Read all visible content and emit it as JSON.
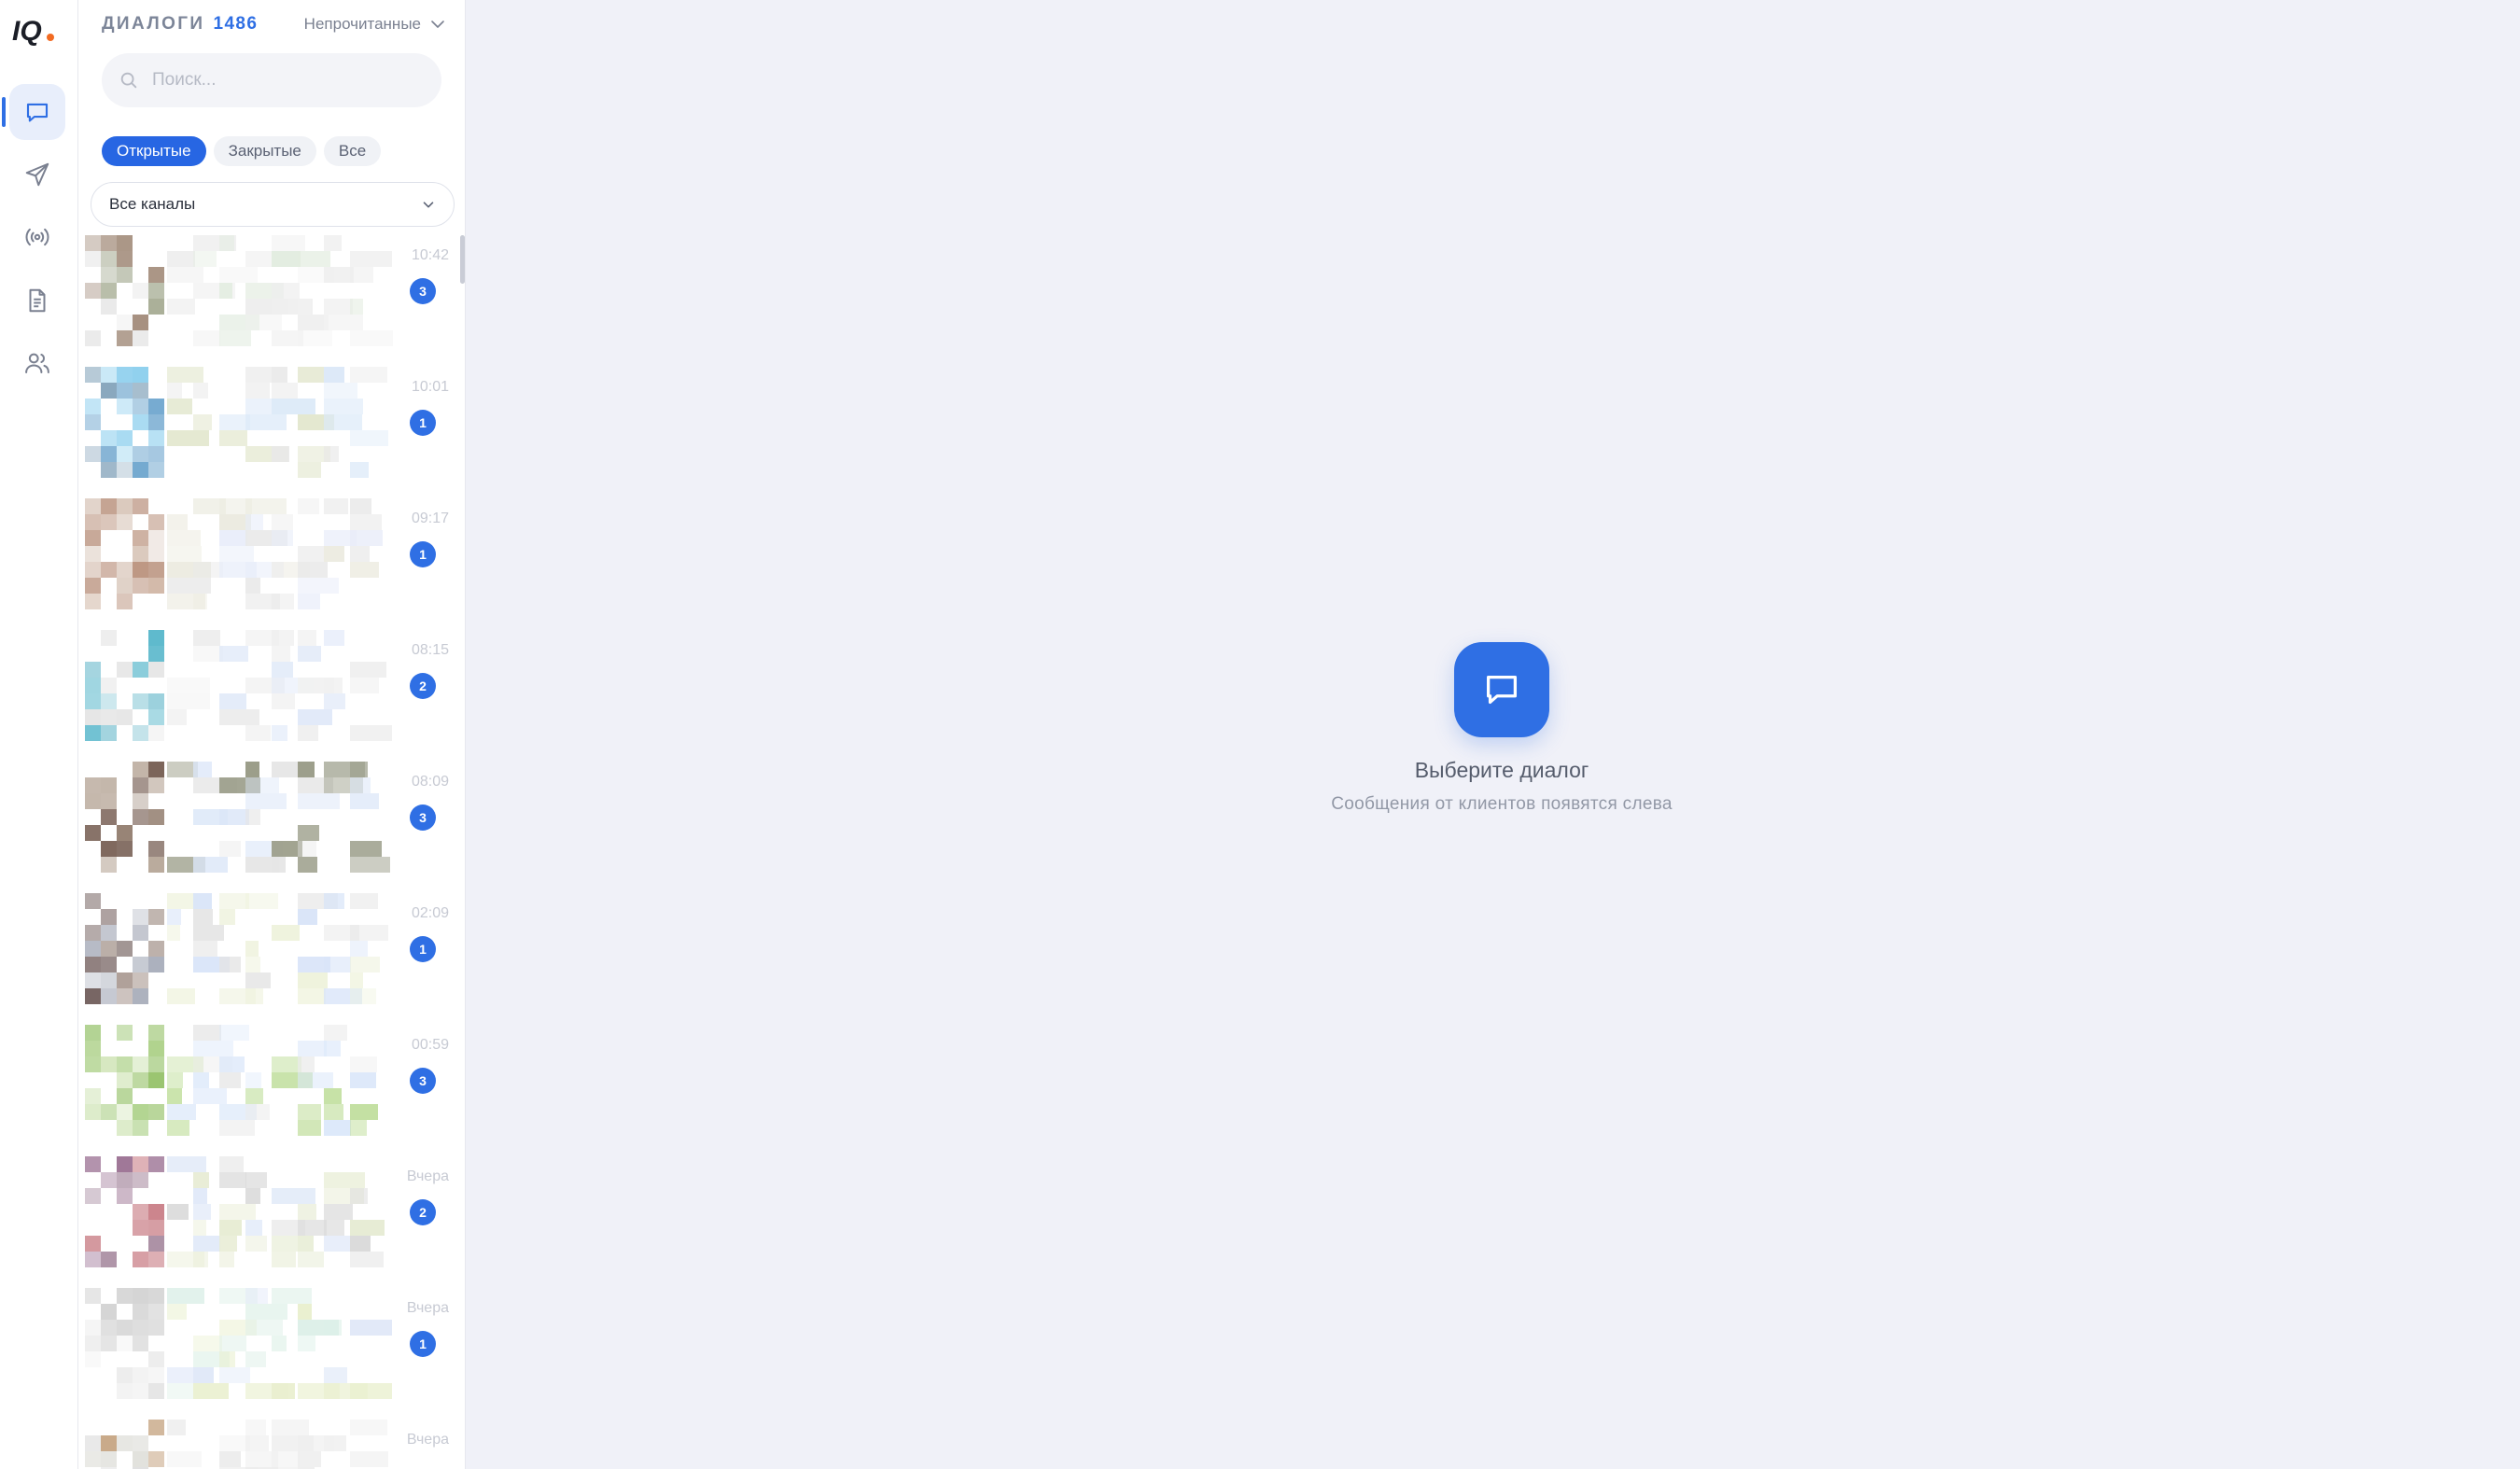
{
  "app": {
    "logo_text": "IQ"
  },
  "rail": {
    "items": [
      {
        "icon": "chat-icon",
        "active": true
      },
      {
        "icon": "send-icon",
        "active": false
      },
      {
        "icon": "broadcast-icon",
        "active": false
      },
      {
        "icon": "document-icon",
        "active": false
      },
      {
        "icon": "users-icon",
        "active": false
      }
    ]
  },
  "dialogs_panel": {
    "title": "ДИАЛОГИ",
    "count": "1486",
    "filter_label": "Непрочитанные",
    "search_placeholder": "Поиск...",
    "tabs": [
      {
        "label": "Открытые",
        "active": true
      },
      {
        "label": "Закрытые",
        "active": false
      },
      {
        "label": "Все",
        "active": false
      }
    ],
    "channel_select": "Все каналы",
    "items": [
      {
        "time": "10:42",
        "unread": "3"
      },
      {
        "time": "10:01",
        "unread": "1"
      },
      {
        "time": "09:17",
        "unread": "1"
      },
      {
        "time": "08:15",
        "unread": "2"
      },
      {
        "time": "08:09",
        "unread": "3"
      },
      {
        "time": "02:09",
        "unread": "1"
      },
      {
        "time": "00:59",
        "unread": "3"
      },
      {
        "time": "Вчера",
        "unread": "2"
      },
      {
        "time": "Вчера",
        "unread": "1"
      },
      {
        "time": "Вчера",
        "unread": ""
      }
    ]
  },
  "empty_state": {
    "title": "Выберите диалог",
    "subtitle": "Сообщения от клиентов появятся слева"
  },
  "colors": {
    "accent": "#2f6fe4",
    "tab_active": "#2766e3",
    "background": "#f0f1f8"
  }
}
